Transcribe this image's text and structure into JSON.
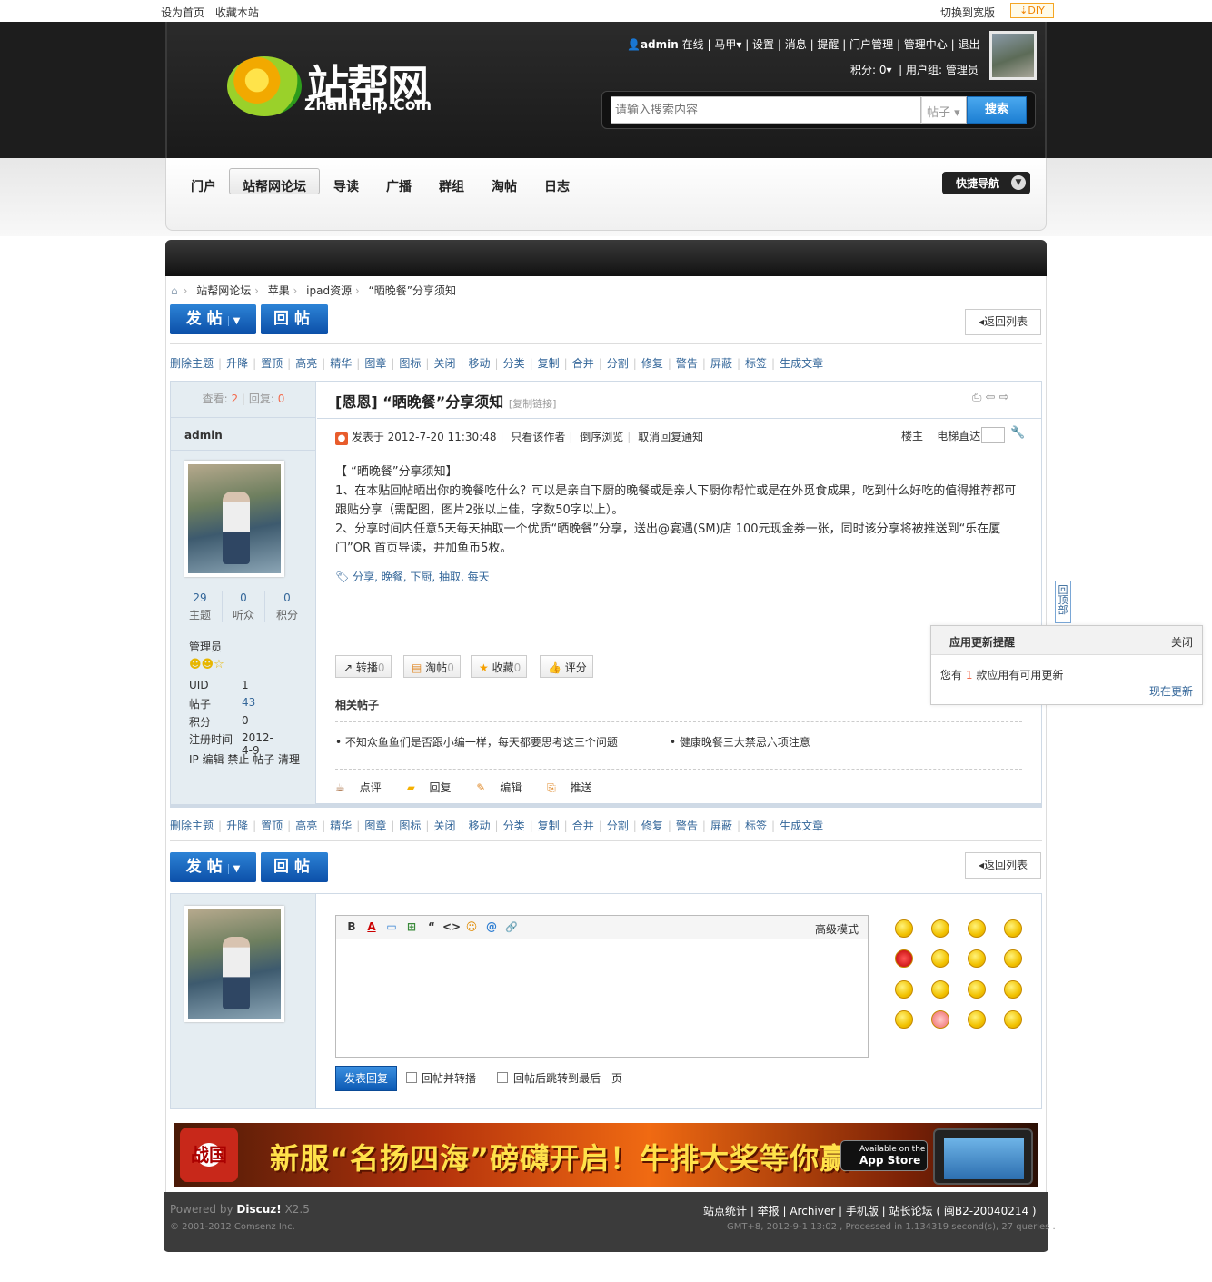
{
  "topbar": {
    "set_home": "设为首页",
    "favorite": "收藏本站",
    "switch_wide": "切换到宽版",
    "diy": "DIY"
  },
  "logo": {
    "name": "站帮网",
    "domain": "ZhanHelp.Com"
  },
  "user": {
    "name": "admin",
    "online": "在线",
    "majia": "马甲",
    "settings": "设置",
    "messages": "消息",
    "remind": "提醒",
    "portal_admin": "门户管理",
    "admin_center": "管理中心",
    "logout": "退出",
    "points": "积分: 0",
    "group": "用户组: 管理员"
  },
  "search": {
    "placeholder": "请输入搜索内容",
    "type": "帖子",
    "button": "搜索"
  },
  "nav": {
    "items": [
      "门户",
      "站帮网论坛",
      "导读",
      "广播",
      "群组",
      "淘帖",
      "日志"
    ],
    "quick": "快捷导航"
  },
  "crumb": [
    "站帮网论坛",
    "苹果",
    "ipad资源",
    "“晒晚餐”分享须知"
  ],
  "buttons": {
    "post": "发帖",
    "reply": "回帖",
    "return": "返回列表"
  },
  "mod_actions": [
    "删除主题",
    "升降",
    "置顶",
    "高亮",
    "精华",
    "图章",
    "图标",
    "关闭",
    "移动",
    "分类",
    "复制",
    "合并",
    "分割",
    "修复",
    "警告",
    "屏蔽",
    "标签",
    "生成文章"
  ],
  "stats": {
    "views_label": "查看:",
    "views": "2",
    "replies_label": "回复:",
    "replies": "0"
  },
  "poster": {
    "name": "admin",
    "counts": [
      {
        "num": "29",
        "label": "主题"
      },
      {
        "num": "0",
        "label": "听众"
      },
      {
        "num": "0",
        "label": "积分"
      }
    ],
    "role": "管理员",
    "uid_label": "UID",
    "uid": "1",
    "posts_label": "帖子",
    "posts": "43",
    "points_label": "积分",
    "points": "0",
    "reg_label": "注册时间",
    "reg": "2012-4-9",
    "admin_links": "IP 编辑 禁止 帖子 清理"
  },
  "thread": {
    "title": "[恩恩] “晒晚餐”分享须知",
    "copy_link": "[复制链接]",
    "posted": "发表于 2012-7-20 11:30:48",
    "only_author": "只看该作者",
    "reverse": "倒序浏览",
    "cancel_notify": "取消回复通知",
    "floor": "楼主",
    "elevator": "电梯直达",
    "body": [
      "【 “晒晚餐”分享须知】",
      "1、在本贴回帖晒出你的晚餐吃什么？可以是亲自下厨的晚餐或是亲人下厨你帮忙或是在外觅食成果，吃到什么好吃的值得推荐都可跟贴分享（需配图，图片2张以上佳，字数50字以上）。",
      "2、分享时间内任意5天每天抽取一个优质“晒晚餐”分享，送出@宴遇(SM)店 100元现金券一张，同时该分享将被推送到“乐在厦门”OR 首页导读，并加鱼币5枚。"
    ],
    "tags": "分享, 晚餐, 下厨, 抽取, 每天",
    "actions": [
      {
        "label": "转播",
        "count": "0"
      },
      {
        "label": "淘帖",
        "count": "0"
      },
      {
        "label": "收藏",
        "count": "0"
      },
      {
        "label": "评分",
        "count": ""
      }
    ],
    "related_title": "相关帖子",
    "related": [
      "• 不知众鱼鱼们是否跟小编一样，每天都要思考这三个问题",
      "• 健康晚餐三大禁忌六项注意"
    ],
    "post_actions": [
      "点评",
      "回复",
      "编辑",
      "推送"
    ]
  },
  "editor": {
    "toolbar": [
      "B",
      "A",
      "▭",
      "⊞",
      "“",
      "<>",
      "☺",
      "@",
      "🔗"
    ],
    "advanced": "高级模式",
    "submit": "发表回复",
    "opt1": "回帖并转播",
    "opt2": "回帖后跳转到最后一页"
  },
  "banner": {
    "logo": "战国",
    "text": "新服“名扬四海”磅礴开启！牛排大奖等你赢",
    "app_small": "Available on the",
    "app_big": "App Store"
  },
  "footer": {
    "powered": "Powered by",
    "brand": "Discuz!",
    "version": "X2.5",
    "copyright": "© 2001-2012 Comsenz Inc.",
    "links": "站点统计 | 举报 | Archiver | 手机版 | 站长论坛 ( 闽B2-20040214 )",
    "processed": "GMT+8, 2012-9-1 13:02 , Processed in 1.134319 second(s), 27 queries ."
  },
  "backtop": "回顶部",
  "notice": {
    "title": "应用更新提醒",
    "close": "关闭",
    "text_pre": "您有",
    "count": "1",
    "text_post": "款应用有可用更新",
    "update": "现在更新"
  }
}
